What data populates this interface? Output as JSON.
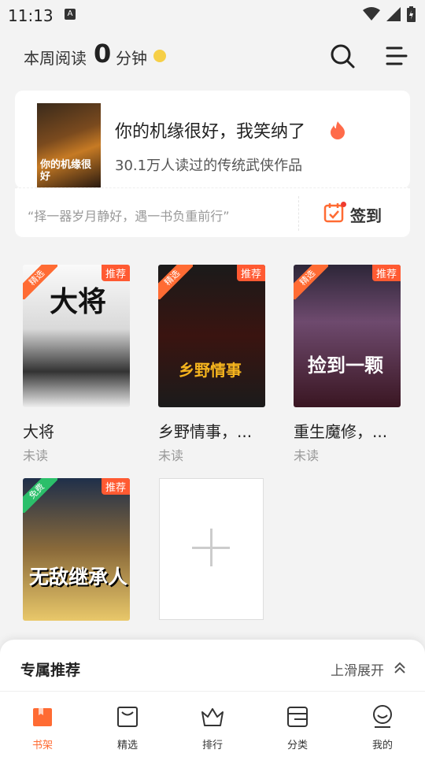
{
  "status_bar": {
    "time": "11:13",
    "badge": "A"
  },
  "header": {
    "read_label": "本周阅读",
    "read_minutes": "0",
    "read_unit": "分钟"
  },
  "featured": {
    "title": "你的机缘很好，我笑纳了",
    "subtitle": "30.1万人读过的传统武侠作品",
    "cover_text": "你的机缘很好"
  },
  "quote_bar": {
    "quote": "“择一器岁月静好，遇一书负重前行”",
    "checkin_label": "签到"
  },
  "books": [
    {
      "title": "大将",
      "status": "未读",
      "tag": "推荐",
      "ribbon": "精选",
      "cover_text": "大将"
    },
    {
      "title": "乡野情事，...",
      "status": "未读",
      "tag": "推荐",
      "ribbon": "精选",
      "cover_text": "乡野情事"
    },
    {
      "title": "重生魔修，...",
      "status": "未读",
      "tag": "推荐",
      "ribbon": "精选",
      "cover_text": "捡到一颗"
    },
    {
      "title": "无敌继承人",
      "status": "",
      "tag": "推荐",
      "ribbon": "免费",
      "cover_text": "无敌继承人"
    }
  ],
  "recommend_panel": {
    "title": "专属推荐",
    "expand_label": "上滑展开"
  },
  "tabs": [
    {
      "label": "书架",
      "icon": "bookshelf-icon"
    },
    {
      "label": "精选",
      "icon": "bag-icon"
    },
    {
      "label": "排行",
      "icon": "crown-icon"
    },
    {
      "label": "分类",
      "icon": "category-icon"
    },
    {
      "label": "我的",
      "icon": "profile-icon"
    }
  ],
  "colors": {
    "accent": "#ff6b33",
    "tag": "#ff5a32",
    "free": "#2bbf6a"
  }
}
